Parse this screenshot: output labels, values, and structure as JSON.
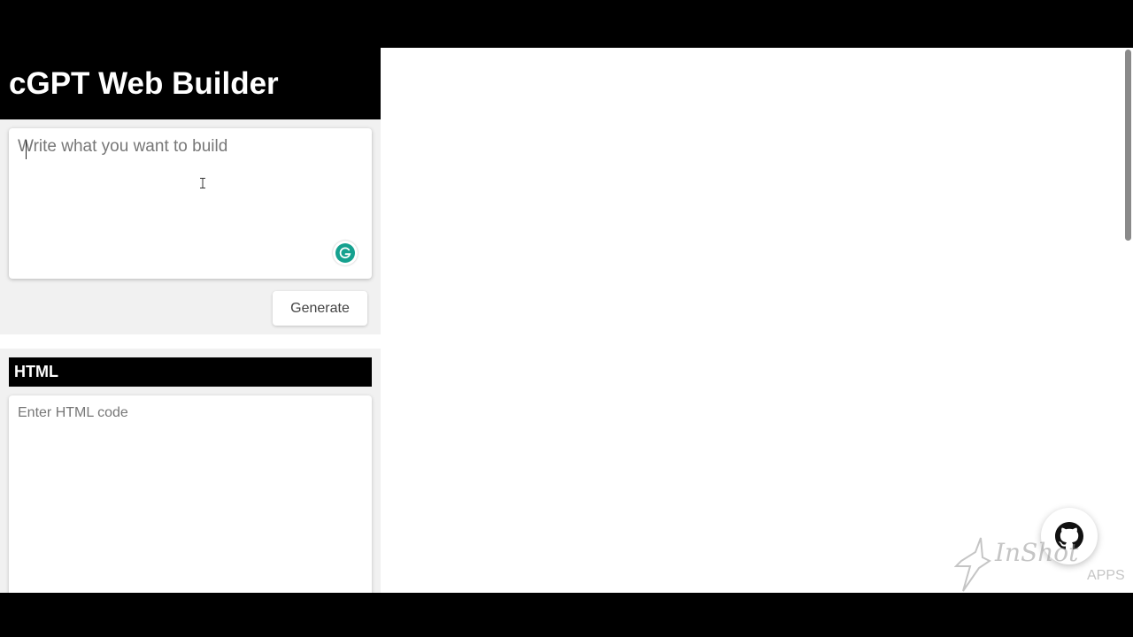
{
  "app": {
    "title": "cGPT Web Builder"
  },
  "prompt": {
    "placeholder": "Write what you want to build",
    "value": "",
    "generate_label": "Generate"
  },
  "html_panel": {
    "header": "HTML",
    "placeholder": "Enter HTML code",
    "value": ""
  },
  "icons": {
    "grammarly": "grammarly-icon",
    "github": "github-icon",
    "cursor": "text-cursor-icon"
  },
  "colors": {
    "header_bg": "#000000",
    "panel_bg": "#f1f1f1",
    "grammarly": "#15a18f"
  },
  "watermark": {
    "text": "InShot",
    "sub": "APPS"
  }
}
